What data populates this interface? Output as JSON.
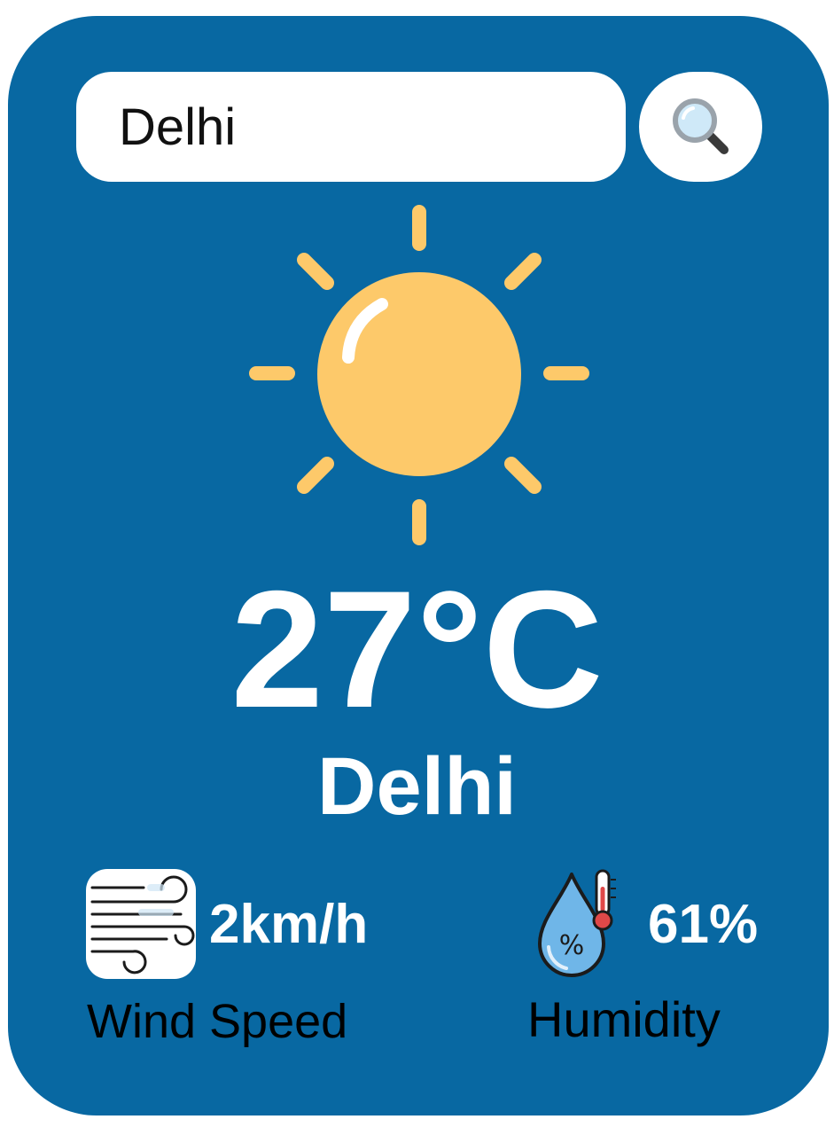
{
  "search": {
    "value": "Delhi",
    "icon": "search-icon"
  },
  "weather": {
    "icon": "sun-icon",
    "temperature": "27°C",
    "city": "Delhi"
  },
  "stats": {
    "wind": {
      "value": "2km/h",
      "label": "Wind Speed",
      "icon": "wind-icon"
    },
    "humidity": {
      "value": "61%",
      "label": "Humidity",
      "icon": "humidity-icon"
    }
  },
  "colors": {
    "card_background": "#0868a2",
    "sun_fill": "#fdc96a",
    "text_light": "#ffffff",
    "text_dark": "#000000"
  }
}
